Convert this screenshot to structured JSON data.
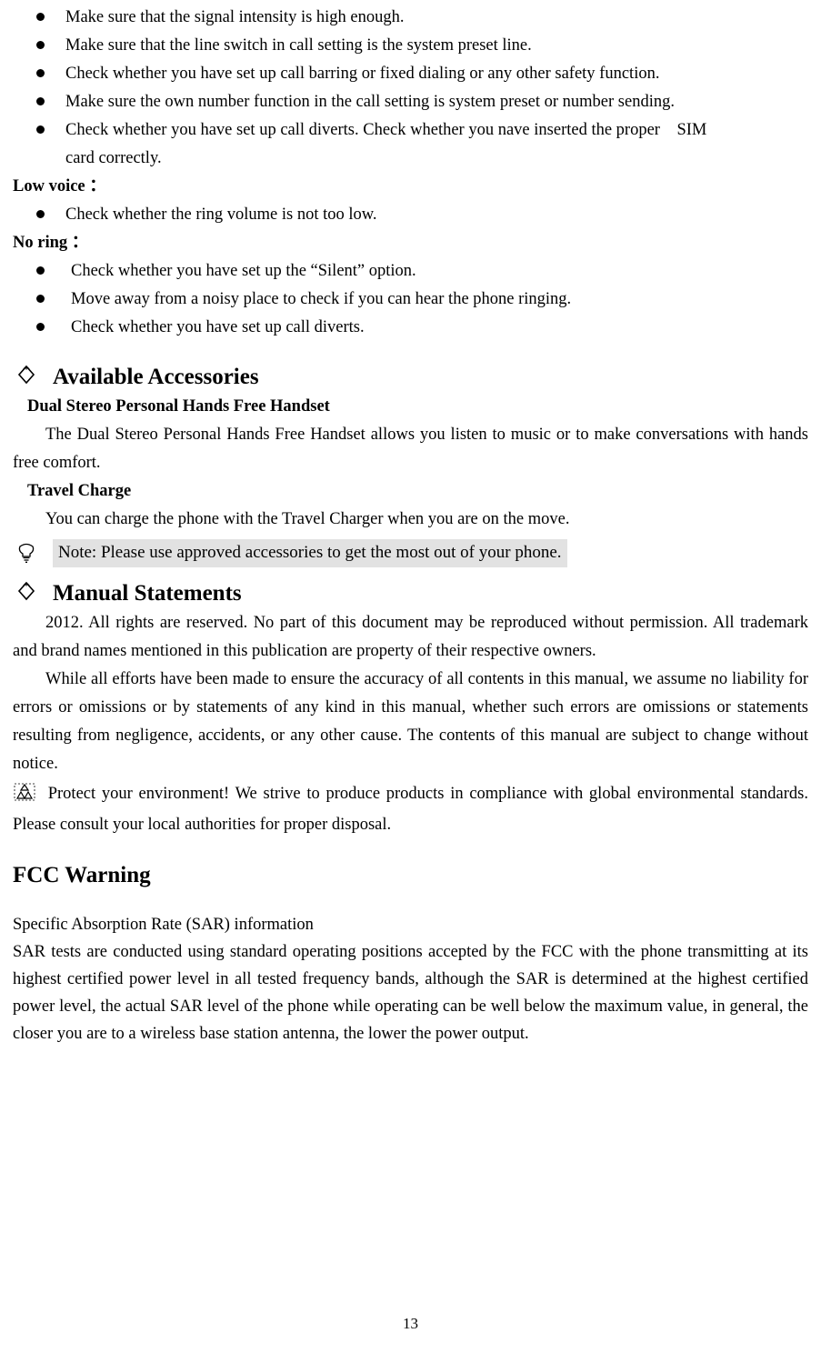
{
  "troubleshooting": {
    "bullets_top": [
      "Make sure that the signal intensity is high enough.",
      "Make sure that the line switch in call setting is the system preset line.",
      "Check whether you have set up call barring or fixed dialing or any other safety function.",
      "Make sure the own number function in the call setting is system preset or number sending.",
      "Check whether you have set up call diverts. Check whether you nave inserted the proper SIM"
    ],
    "bullet_cont": "card correctly.",
    "low_voice_heading": "Low voice  ：",
    "low_voice_bullets": [
      "Check whether the ring volume is not too low."
    ],
    "no_ring_heading": "No ring  ：",
    "no_ring_bullets": [
      "Check whether you have set up the “Silent” option.",
      "Move away from a noisy place to check if you can hear the phone ringing.",
      "Check whether you have set up call diverts."
    ]
  },
  "accessories": {
    "heading": "Available Accessories",
    "items": [
      {
        "title": "Dual Stereo Personal Hands Free Handset",
        "body": "The Dual Stereo Personal Hands Free Handset allows you listen to music or to make conversations with hands free comfort."
      },
      {
        "title": "Travel Charge",
        "body": "You can charge the phone with the Travel Charger when you are on the move."
      }
    ],
    "note": "Note: Please use approved accessories to get the most out of your phone."
  },
  "manual_statements": {
    "heading": "Manual Statements",
    "paragraphs": [
      "2012. All rights are reserved. No part of this document may be reproduced without permission. All trademark and brand names mentioned in this publication are property of their respective owners.",
      "While all efforts have been made to ensure the accuracy of all contents in this manual, we assume no liability for errors or omissions or by statements of any kind in this manual, whether such errors are omissions or statements resulting from negligence, accidents, or any other cause. The contents of this manual are subject to change without notice."
    ],
    "environment_paragraph": "Protect your environment! We strive to produce products in compliance with global environmental standards. Please consult your local authorities for proper disposal."
  },
  "fcc": {
    "heading": "FCC Warning",
    "sar_line": "Specific Absorption Rate (SAR) information",
    "sar_paragraph": "SAR tests are conducted using standard operating positions accepted by the FCC with the phone transmitting at its highest certified power level in all tested frequency bands, although the SAR is determined at the highest certified power level, the actual SAR level of the phone while operating can be well below the maximum value, in general, the closer you are to a wireless base station antenna, the lower the power output."
  },
  "footer": {
    "page_number": "13"
  },
  "icons": {
    "bullet": "filled-circle-icon",
    "section": "diamond-outline-icon",
    "note": "lightbulb-icon",
    "environment": "recycle-icon"
  },
  "colors": {
    "text": "#000000",
    "note_highlight": "#e2e2e2",
    "page_background": "#ffffff"
  }
}
